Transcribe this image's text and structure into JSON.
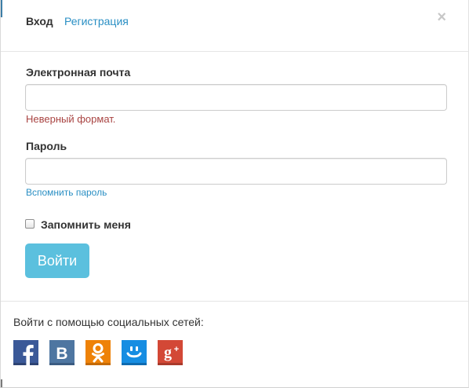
{
  "header": {
    "tab_login": "Вход",
    "tab_register": "Регистрация",
    "close_glyph": "×"
  },
  "form": {
    "email_label": "Электронная почта",
    "email_value": "",
    "email_error": "Неверный формат.",
    "password_label": "Пароль",
    "password_value": "",
    "forgot_password": "Вспомнить пароль",
    "remember_label": "Запомнить меня",
    "remember_checked": false,
    "submit_label": "Войти"
  },
  "social": {
    "prompt": "Войти с помощью социальных сетей:",
    "providers": [
      {
        "name": "facebook-icon",
        "color": "#3b5998"
      },
      {
        "name": "vkontakte-icon",
        "color": "#4e76a1"
      },
      {
        "name": "odnoklassniki-icon",
        "color": "#ee8208"
      },
      {
        "name": "mailru-icon",
        "color": "#168de2"
      },
      {
        "name": "google-plus-icon",
        "color": "#d34836"
      }
    ]
  },
  "colors": {
    "link": "#2a8fc4",
    "error": "#a94442",
    "button": "#5bc0de"
  }
}
